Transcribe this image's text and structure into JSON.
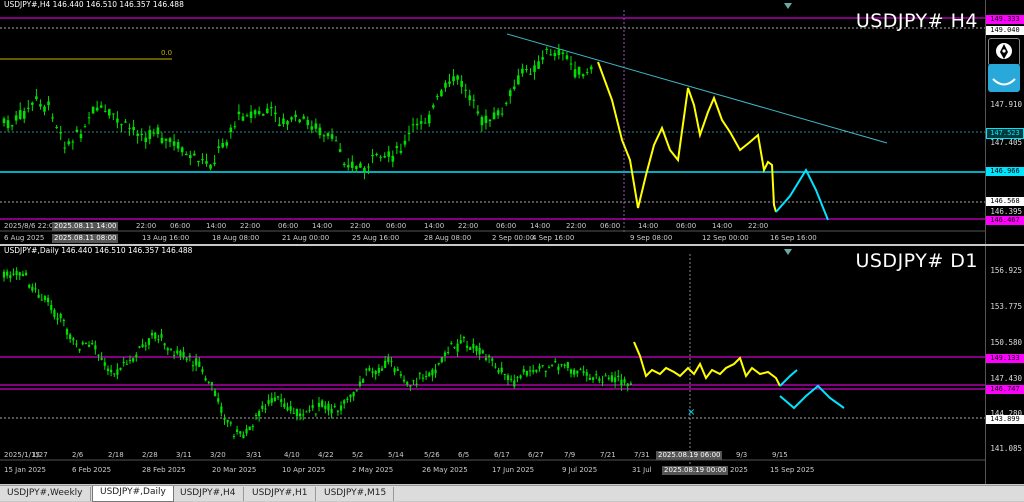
{
  "top": {
    "info": "USDJPY#,H4  146.440 146.510 146.357 146.488",
    "symbol": "USDJPY# H4",
    "price_ticks": [
      "147.910",
      "147.405",
      "146.395"
    ],
    "price_boxes": {
      "a": "149.333",
      "b": "149.040",
      "c": "147.523",
      "d": "146.966",
      "e": "146.568",
      "f": "146.467"
    },
    "fib_label": "0.0",
    "time_labels": [
      "6 Aug 2025",
      "13 Aug 16:00",
      "18 Aug 08:00",
      "21 Aug 00:00",
      "25 Aug 16:00",
      "28 Aug 08:00",
      "2 Sep 00:00",
      "4 Sep 16:00",
      "9 Sep 08:00",
      "12 Sep 00:00",
      "16 Sep 16:00"
    ],
    "sub_labels": [
      "2025/8/6 22:00",
      "22:00",
      "06:00",
      "14:00",
      "22:00",
      "06:00",
      "14:00",
      "22:00",
      "06:00",
      "14:00",
      "22:00",
      "06:00",
      "14:00",
      "22:00",
      "06:00",
      "14:00",
      "06:00",
      "14:00",
      "22:00"
    ],
    "crosshair_time": "2025.08.11 14:00",
    "crosshair_time2": "2025.08.11 08:00"
  },
  "bottom": {
    "info": "USDJPY#,Daily  146.440 146.510 146.357 146.488",
    "symbol": "USDJPY# D1",
    "price_ticks": [
      "156.925",
      "153.775",
      "150.580",
      "147.430",
      "144.280",
      "141.085"
    ],
    "price_boxes": {
      "a": "149.133",
      "b": "146.747",
      "c": "143.899"
    },
    "time_labels": [
      "15 Jan 2025",
      "6 Feb 2025",
      "28 Feb 2025",
      "20 Mar 2025",
      "10 Apr 2025",
      "2 May 2025",
      "26 May 2025",
      "17 Jun 2025",
      "9 Jul 2025",
      "31 Jul",
      "2025.08.19 00:00",
      "2025",
      "15 Sep 2025"
    ],
    "sub_labels": [
      "2025/1/15",
      "1/27",
      "2/6",
      "2/18",
      "2/28",
      "3/11",
      "3/20",
      "3/31",
      "4/10",
      "4/22",
      "5/2",
      "5/14",
      "5/26",
      "6/5",
      "6/17",
      "6/27",
      "7/9",
      "7/21",
      "7/31",
      "9/3",
      "9/15"
    ],
    "crosshair_time": "2025.08.19 06:00"
  },
  "tabs": [
    {
      "label": "USDJPY#,Weekly",
      "active": false
    },
    {
      "label": "USDJPY#,Daily",
      "active": true
    },
    {
      "label": "USDJPY#,H4",
      "active": false
    },
    {
      "label": "USDJPY#,H1",
      "active": false
    },
    {
      "label": "USDJPY#,M15",
      "active": false
    }
  ],
  "colors": {
    "candle": "#00e000",
    "magenta": "#ff00ff",
    "cyan": "#00e5ff",
    "yellow": "#ffff00",
    "trend": "#3fb6c6"
  }
}
